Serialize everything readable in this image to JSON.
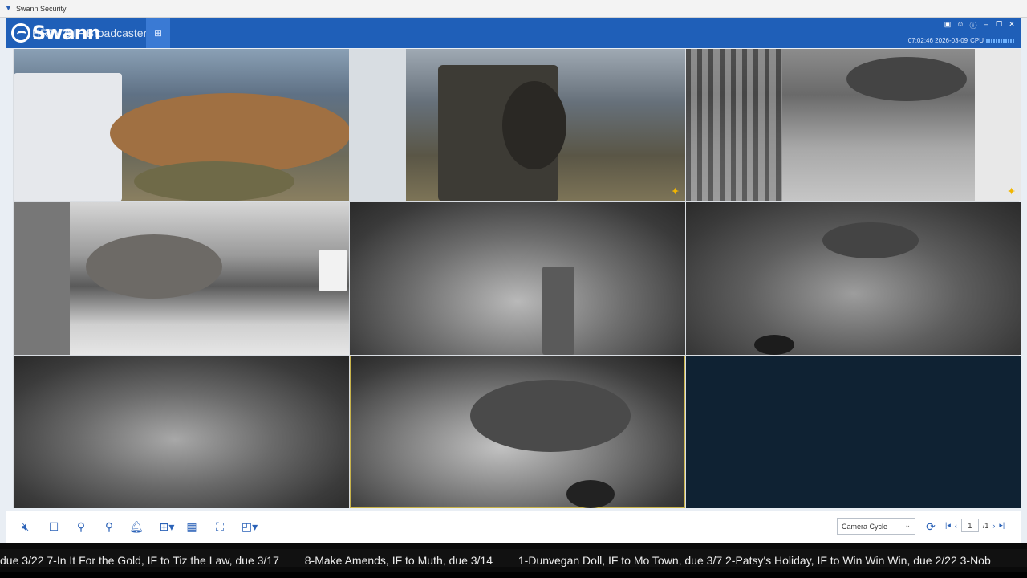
{
  "window": {
    "title": "Swann Security"
  },
  "header": {
    "logo_text": "Swann",
    "tab_label": "HRTV's IF Broadcaster",
    "tab_add": "+",
    "datetime": "07:02:46 2026-03-09",
    "cpu_label": "CPU",
    "icons": [
      "screen-icon",
      "user-icon",
      "info-icon",
      "minimize-icon",
      "restore-icon",
      "close-icon"
    ]
  },
  "cameras": [
    {
      "label": "camera-1",
      "mode": "color",
      "motion": false
    },
    {
      "label": "camera-2",
      "mode": "color",
      "motion": true
    },
    {
      "label": "camera-3",
      "mode": "day-bw",
      "motion": true
    },
    {
      "label": "camera-4",
      "mode": "day-bw",
      "motion": false
    },
    {
      "label": "camera-5",
      "mode": "night",
      "motion": false
    },
    {
      "label": "camera-6",
      "mode": "night",
      "motion": false
    },
    {
      "label": "camera-7",
      "mode": "night",
      "motion": false
    },
    {
      "label": "camera-8",
      "mode": "night",
      "motion": false,
      "selected": true
    },
    {
      "label": "camera-9",
      "mode": "empty",
      "motion": false
    }
  ],
  "toolbar": {
    "cycle_select": "Camera Cycle",
    "page_current": "1",
    "page_total": "/1",
    "icons": [
      "mute-icon",
      "stop-icon",
      "light-icon",
      "light-alt-icon",
      "alarm-bell-icon",
      "grid-layout-icon",
      "save-icon",
      "fullscreen-icon",
      "aspect-icon"
    ]
  },
  "ticker": {
    "items": [
      "due 3/22  7-In It For the Gold, IF to Tiz the Law, due 3/17",
      "8-Make Amends, IF to Muth, due 3/14",
      "1-Dunvegan Doll, IF to Mo Town, due 3/7  2-Patsy's Holiday, IF to Win Win Win, due 2/22  3-Nob"
    ]
  },
  "colors": {
    "header_blue": "#1f5fb8",
    "tab_add_blue": "#3a7ad4",
    "motion_icon": "#f2b600",
    "empty_tile": "#0f2233",
    "selected_border": "#c7b24a"
  }
}
